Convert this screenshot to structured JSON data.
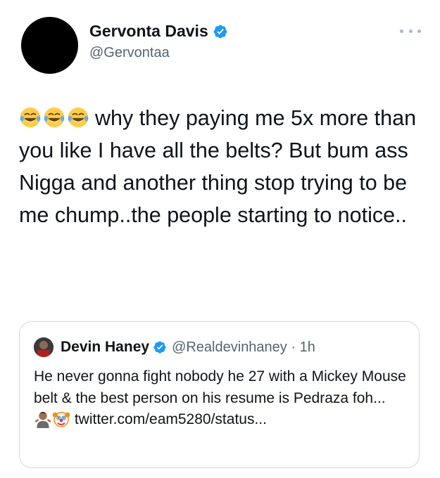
{
  "tweet": {
    "author": {
      "display_name": "Gervonta Davis",
      "handle": "@Gervontaa",
      "verified": true,
      "avatar_icon": "avatar-black-circle"
    },
    "more_icon": "ellipsis-icon",
    "emojis": [
      "face-with-tears-of-joy",
      "face-with-tears-of-joy",
      "face-with-tears-of-joy"
    ],
    "text": "why they paying me 5x more than you like I have all the belts? But bum ass Nigga and another thing stop trying to be me chump..the people starting to notice.."
  },
  "quoted_tweet": {
    "display_name": "Devin Haney",
    "verified": true,
    "handle_time": "@Realdevinhaney · 1h",
    "text_before": "He never gonna fight nobody he 27 with a Mickey Mouse belt & the best person on his resume is Pedraza foh... ",
    "emojis": [
      "man-shrugging",
      "clown-face"
    ],
    "text_after": " twitter.com/​eam5280/status..."
  },
  "colors": {
    "text": "#0f1419",
    "secondary": "#536471",
    "verified": "#1d9bf0",
    "border": "#cfd9de"
  }
}
